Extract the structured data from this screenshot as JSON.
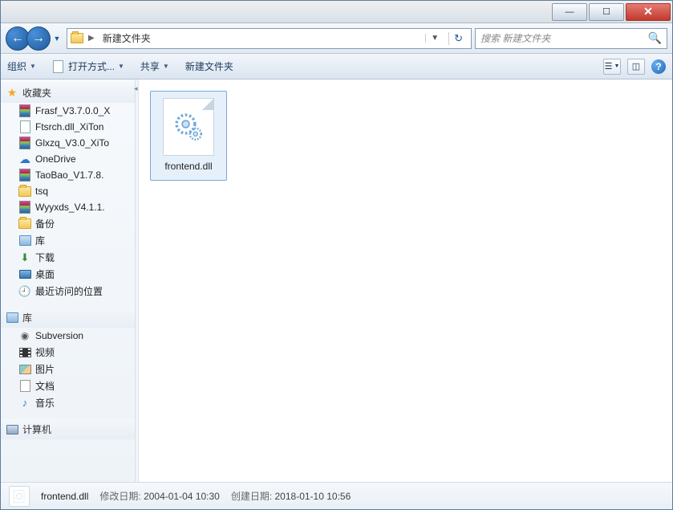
{
  "titlebar": {
    "min": "—",
    "max": "☐",
    "close": "✕"
  },
  "nav": {
    "back": "←",
    "forward": "→",
    "crumb_sep": "▶",
    "crumb": "新建文件夹",
    "drop": "▼",
    "refresh": "↻"
  },
  "search": {
    "placeholder": "搜索 新建文件夹",
    "icon": "🔍"
  },
  "toolbar": {
    "organize": "组织",
    "openwith": "打开方式...",
    "share": "共享",
    "newfolder": "新建文件夹",
    "help": "?"
  },
  "sidebar": {
    "groups": [
      {
        "head": "收藏夹",
        "head_icon": "star",
        "items": [
          {
            "icon": "rar",
            "label": "Frasf_V3.7.0.0_X"
          },
          {
            "icon": "doc",
            "label": "Ftsrch.dll_XiTon"
          },
          {
            "icon": "rar",
            "label": "Glxzq_V3.0_XiTo"
          },
          {
            "icon": "cloud",
            "label": "OneDrive"
          },
          {
            "icon": "rar",
            "label": "TaoBao_V1.7.8."
          },
          {
            "icon": "folder",
            "label": "tsq"
          },
          {
            "icon": "rar",
            "label": "Wyyxds_V4.1.1."
          },
          {
            "icon": "folder",
            "label": "备份"
          },
          {
            "icon": "lib",
            "label": "库"
          },
          {
            "icon": "dl",
            "label": "下载"
          },
          {
            "icon": "desk",
            "label": "桌面"
          },
          {
            "icon": "recent",
            "label": "最近访问的位置"
          }
        ]
      },
      {
        "head": "库",
        "head_icon": "lib",
        "items": [
          {
            "icon": "svn",
            "label": "Subversion"
          },
          {
            "icon": "vid",
            "label": "视频"
          },
          {
            "icon": "img",
            "label": "图片"
          },
          {
            "icon": "txt",
            "label": "文档"
          },
          {
            "icon": "mus",
            "label": "音乐"
          }
        ]
      },
      {
        "head": "计算机",
        "head_icon": "pc",
        "items": []
      }
    ]
  },
  "content": {
    "files": [
      {
        "name": "frontend.dll",
        "selected": true
      }
    ]
  },
  "status": {
    "name": "frontend.dll",
    "mod_label": "修改日期:",
    "mod_value": "2004-01-04 10:30",
    "create_label": "创建日期:",
    "create_value": "2018-01-10 10:56"
  }
}
